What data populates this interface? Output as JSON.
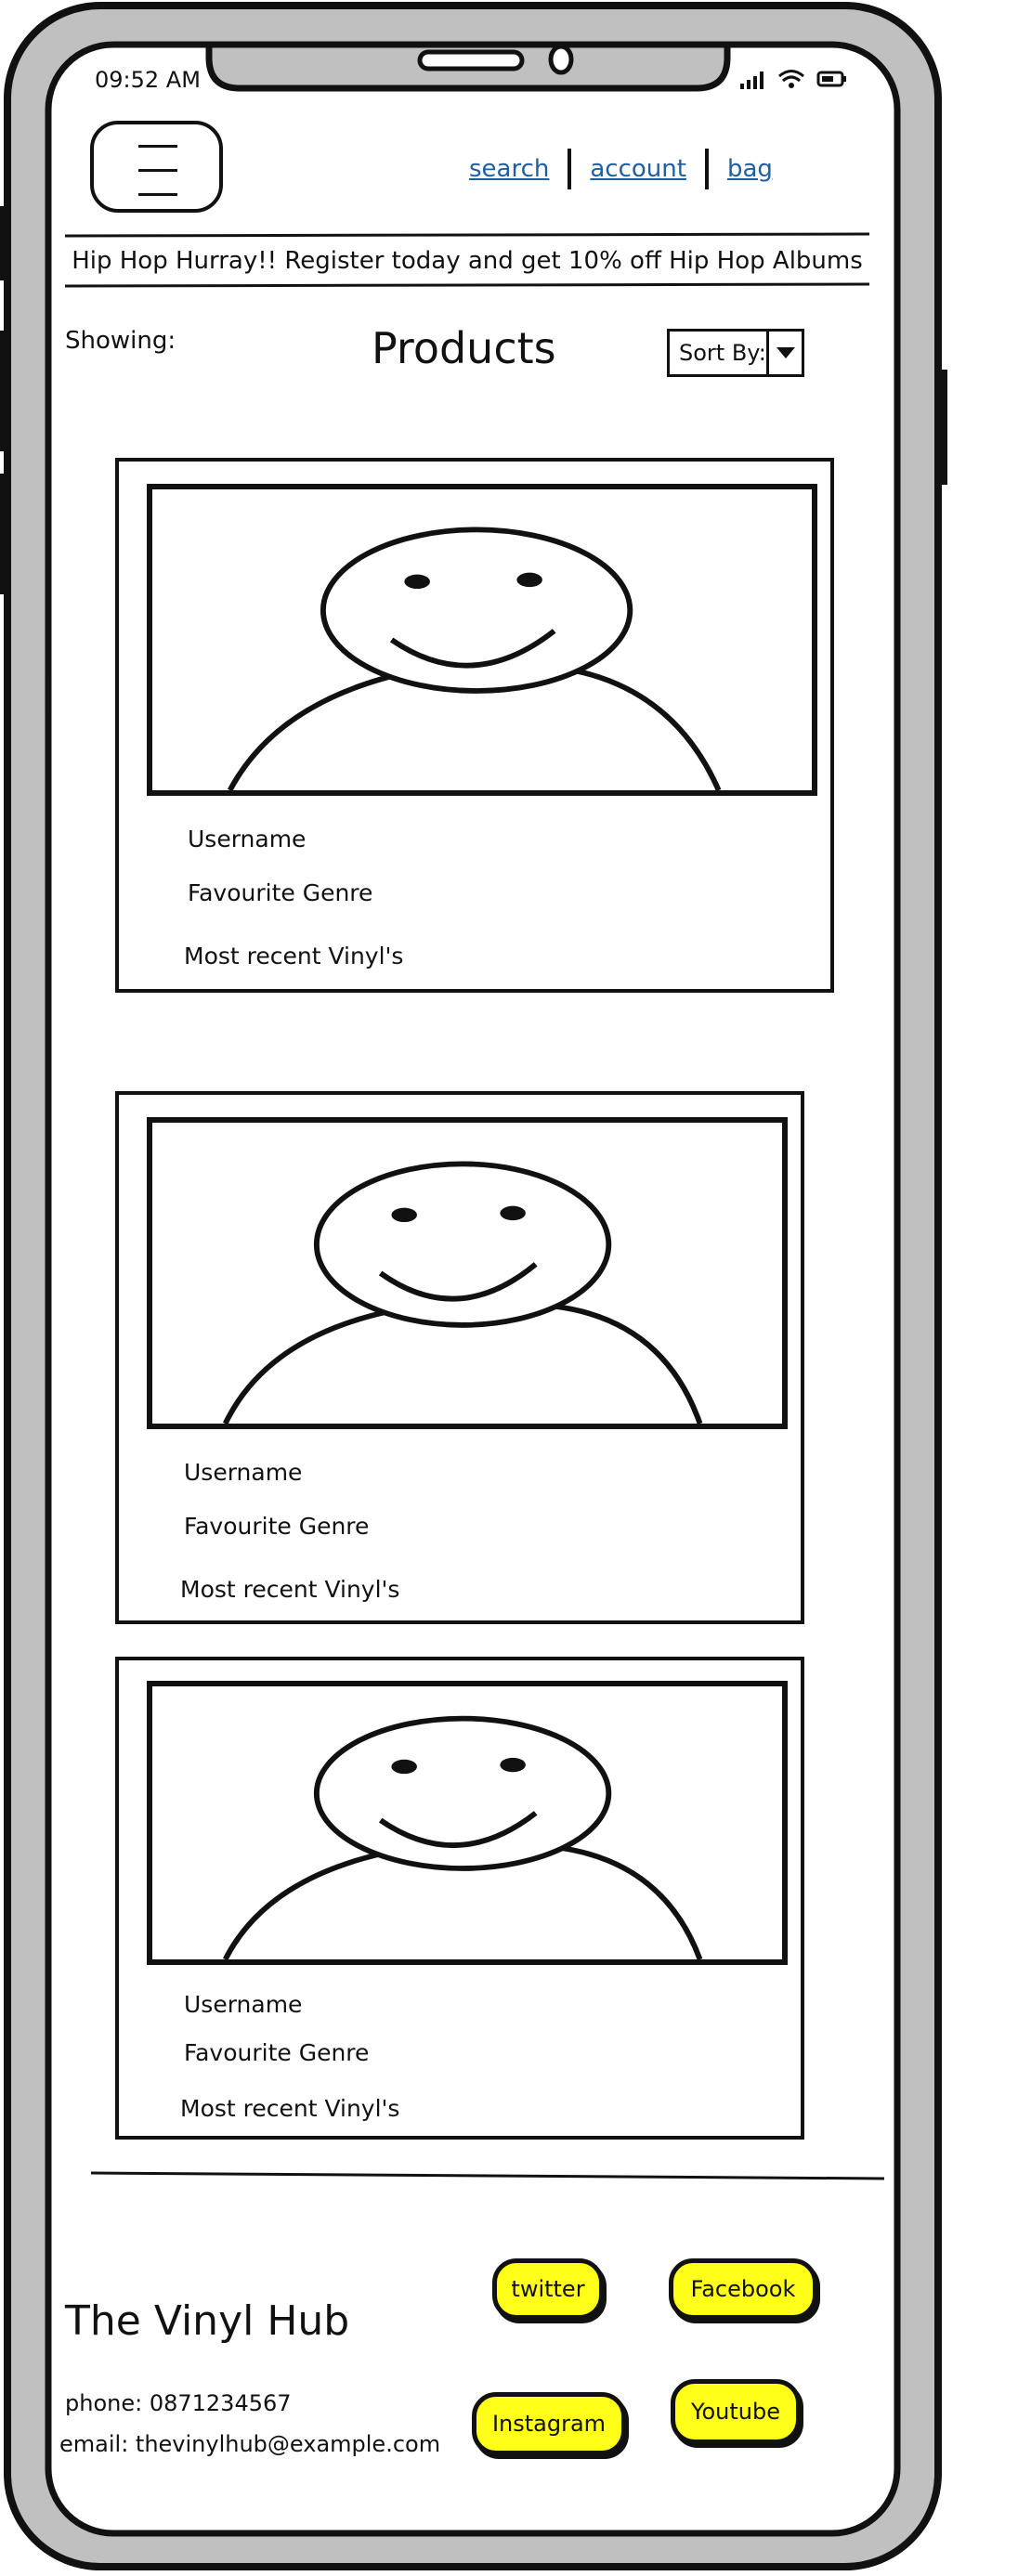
{
  "status_bar": {
    "time": "09:52 AM",
    "icons": [
      "signal-icon",
      "wifi-icon",
      "battery-icon"
    ]
  },
  "header": {
    "menu_icon": "hamburger-icon",
    "nav": [
      {
        "label": "search"
      },
      {
        "label": "account"
      },
      {
        "label": "bag"
      }
    ]
  },
  "promo": {
    "text": "Hip Hop Hurray!! Register today and get 10% off Hip Hop Albums"
  },
  "toolbar": {
    "showing_label": "Showing:",
    "title": "Products",
    "sort_label": "Sort By:"
  },
  "cards": [
    {
      "image": "user-placeholder-image",
      "username": "Username",
      "genre": "Favourite Genre",
      "recent": "Most recent Vinyl's"
    },
    {
      "image": "user-placeholder-image",
      "username": "Username",
      "genre": "Favourite Genre",
      "recent": "Most recent Vinyl's"
    },
    {
      "image": "user-placeholder-image",
      "username": "Username",
      "genre": "Favourite Genre",
      "recent": "Most recent Vinyl's"
    }
  ],
  "footer": {
    "brand": "The Vinyl Hub",
    "phone": "phone: 0871234567",
    "email": "email: thevinylhub@example.com",
    "social": [
      {
        "label": "twitter"
      },
      {
        "label": "Facebook"
      },
      {
        "label": "Instagram"
      },
      {
        "label": "Youtube"
      }
    ]
  },
  "colors": {
    "accent": "#ffff1a",
    "link": "#1f5fa0",
    "frame": "#c0c0c0",
    "ink": "#111111"
  }
}
